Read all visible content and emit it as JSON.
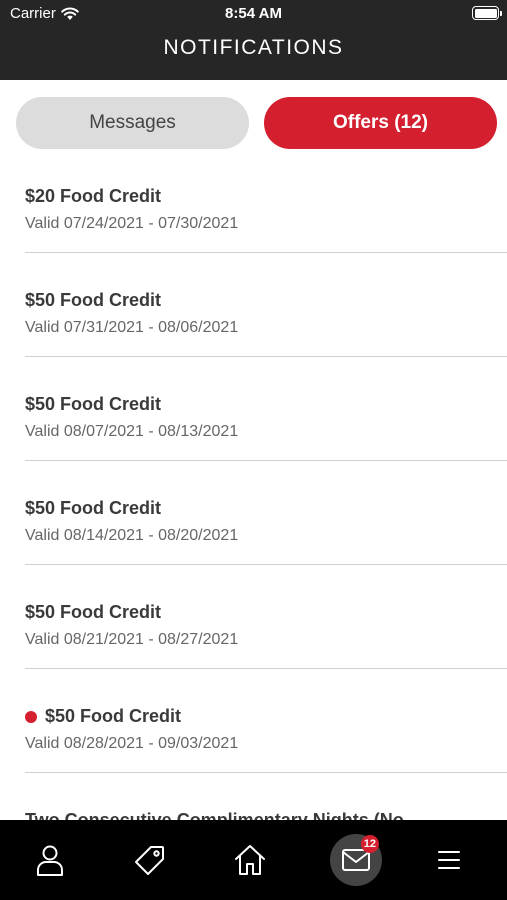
{
  "status_bar": {
    "carrier": "Carrier",
    "time": "8:54 AM"
  },
  "header": {
    "title": "NOTIFICATIONS"
  },
  "tabs": [
    {
      "label": "Messages",
      "active": false
    },
    {
      "label": "Offers (12)",
      "active": true
    }
  ],
  "offers": [
    {
      "title": "$20 Food Credit",
      "validity": "Valid 07/24/2021 - 07/30/2021",
      "unread": false
    },
    {
      "title": "$50 Food Credit",
      "validity": "Valid 07/31/2021 - 08/06/2021",
      "unread": false
    },
    {
      "title": "$50 Food Credit",
      "validity": "Valid 08/07/2021 - 08/13/2021",
      "unread": false
    },
    {
      "title": "$50 Food Credit",
      "validity": "Valid 08/14/2021 - 08/20/2021",
      "unread": false
    },
    {
      "title": "$50 Food Credit",
      "validity": "Valid 08/21/2021 - 08/27/2021",
      "unread": false
    },
    {
      "title": "$50 Food Credit",
      "validity": "Valid 08/28/2021 - 09/03/2021",
      "unread": true
    },
    {
      "title": "Two Consecutive Complimentary Nights (No",
      "validity": "",
      "unread": false
    }
  ],
  "bottom_nav": {
    "items": [
      {
        "name": "profile",
        "icon": "person-icon"
      },
      {
        "name": "offers",
        "icon": "tag-icon"
      },
      {
        "name": "home",
        "icon": "home-icon"
      },
      {
        "name": "inbox",
        "icon": "mail-icon",
        "active": true,
        "badge": "12"
      },
      {
        "name": "menu",
        "icon": "hamburger-menu-icon"
      }
    ]
  },
  "colors": {
    "accent": "#d41f2f",
    "header_bg": "#262626",
    "tab_inactive_bg": "#dcdcdc",
    "nav_bg": "#000000"
  }
}
